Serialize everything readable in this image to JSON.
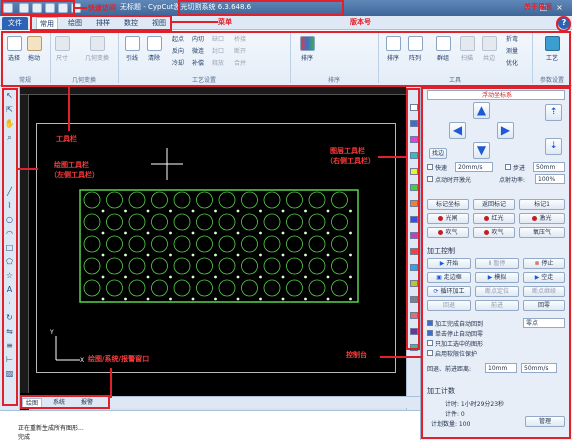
{
  "titlebar": {
    "title": "无标题 - CypCut激光切割系统 6.3.648.6",
    "window_buttons": [
      "–",
      "□",
      "×"
    ]
  },
  "menu": {
    "tabs": [
      "文件",
      "常用",
      "绘图",
      "排样",
      "数控",
      "视图"
    ]
  },
  "ribbon": {
    "buttons": {
      "select": "选择",
      "drag": "拖动",
      "size": "尺寸",
      "geo_transform": "几何变换",
      "lead": "引线",
      "clear": "清除",
      "sort": "排序",
      "order": "排序",
      "array": "阵列",
      "group": "群组",
      "scan": "扫描",
      "co_edge": "共边",
      "process": "工艺"
    },
    "small": {
      "start_point": "起点",
      "reverse": "反向",
      "cooling": "冷却",
      "inner_cut": "内切",
      "microjoint": "微连",
      "seal": "封口",
      "gap": "缺口",
      "bridge": "桥接",
      "compensate": "补偿",
      "release": "释放",
      "break": "断开",
      "merge": "合并",
      "fold": "折弯",
      "measure": "测量",
      "optimize": "优化"
    },
    "groups": [
      "常规",
      "几何变换",
      "工艺设置",
      "排序",
      "工具",
      "参数设置"
    ]
  },
  "bottom": {
    "tabs": [
      "绘图",
      "系统",
      "报警"
    ],
    "output_lines": [
      "正在重新生成所有图形...",
      "完成"
    ]
  },
  "panel": {
    "coordinate_system": "浮动坐标系",
    "arrows": [
      "▲",
      "◀",
      "▶",
      "▼"
    ],
    "find_edge": "找边",
    "fast_label": "快速",
    "fast_value": "20mm/s",
    "step_label": "步进",
    "step_value": "50mm",
    "spot_label": "点动时开激光",
    "power_label": "点射功率:",
    "power_value": "100%",
    "btn_mark_origin": "标记坐标",
    "btn_return_mark": "返回标记",
    "mark_select": "标记1",
    "btn_shutter": "光闸",
    "btn_red_light": "红光",
    "btn_laser": "激光",
    "btn_blow": "吹气",
    "btn_blow2": "吹气",
    "gas_select": "氧压气",
    "section_control": "加工控制",
    "btn_start": "开始",
    "btn_pause": "暂停",
    "btn_stop": "停止",
    "btn_walk_frame": "走边框",
    "btn_simulate": "模拟",
    "btn_idle": "空走",
    "btn_loop": "循环加工",
    "btn_breakpoint": "断点定位",
    "btn_continue": "断点继续",
    "btn_back": "回退",
    "btn_forward": "前进",
    "btn_return": "回零",
    "chk_auto_return": "加工完成自动回到",
    "return_target": "零点",
    "chk_single": "单击停止自动回零",
    "chk_selected": "只加工选中的图形",
    "chk_soft_limit": "启用软限位保护",
    "back_step_label": "回退、前进距离:",
    "back_step_value": "10mm",
    "speed_value": "50mm/s",
    "section_count": "加工计数",
    "count_time": "计时: 1小时29分23秒",
    "count_times": "计件: 0",
    "count_plan": "计划数量: 100",
    "btn_manage": "管理"
  },
  "annotations": {
    "quick_access": "快速访问",
    "menu": "菜单",
    "version": "版本号",
    "about": "关于界面",
    "toolbar": "工具栏",
    "draw_toolbar_1": "绘图工具栏",
    "draw_toolbar_2": "（左侧工具栏）",
    "layer_toolbar_1": "图层工具栏",
    "layer_toolbar_2": "（右侧工具栏）",
    "status_window": "绘图/系统/报警窗口",
    "console": "控制台"
  },
  "colors": {
    "callout": "#e0202a",
    "pattern": "#58d24a",
    "layer_swatches": [
      "#ffffff",
      "#3a6fd0",
      "#e040e0",
      "#30c0c0",
      "#f0f030",
      "#40d040",
      "#f08030",
      "#3050f0",
      "#c040c0",
      "#f04040",
      "#30a0f0",
      "#c0c030",
      "#808080",
      "#e07070",
      "#7030a0",
      "#40c080"
    ]
  }
}
